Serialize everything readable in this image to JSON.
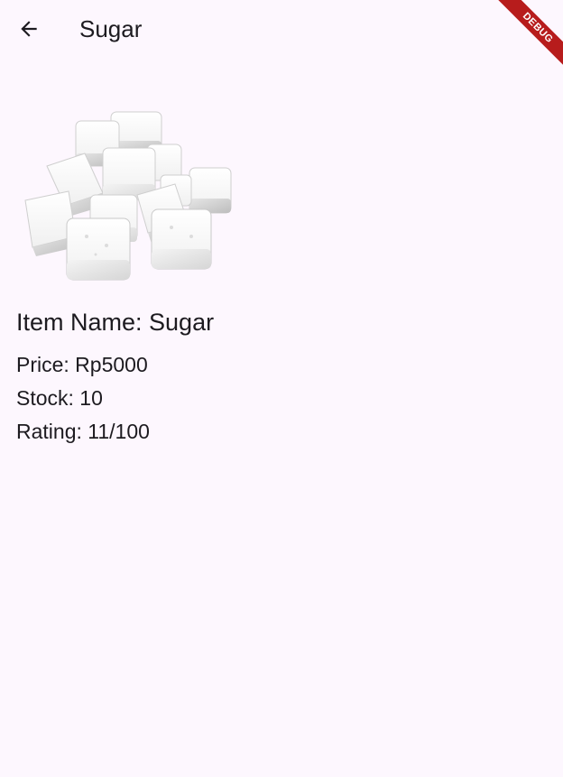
{
  "app_bar": {
    "title": "Sugar",
    "back_icon": "arrow-left-icon"
  },
  "debug_banner": {
    "label": "DEBUG",
    "color": "#b71c1c"
  },
  "product": {
    "image_icon": "sugar-cubes-image",
    "name_line": "Item Name: Sugar",
    "price_line": "Price: Rp5000",
    "stock_line": "Stock: 10",
    "rating_line": "Rating: 11/100"
  },
  "theme": {
    "background": "#fdf7fe",
    "text": "#1d1b20"
  }
}
